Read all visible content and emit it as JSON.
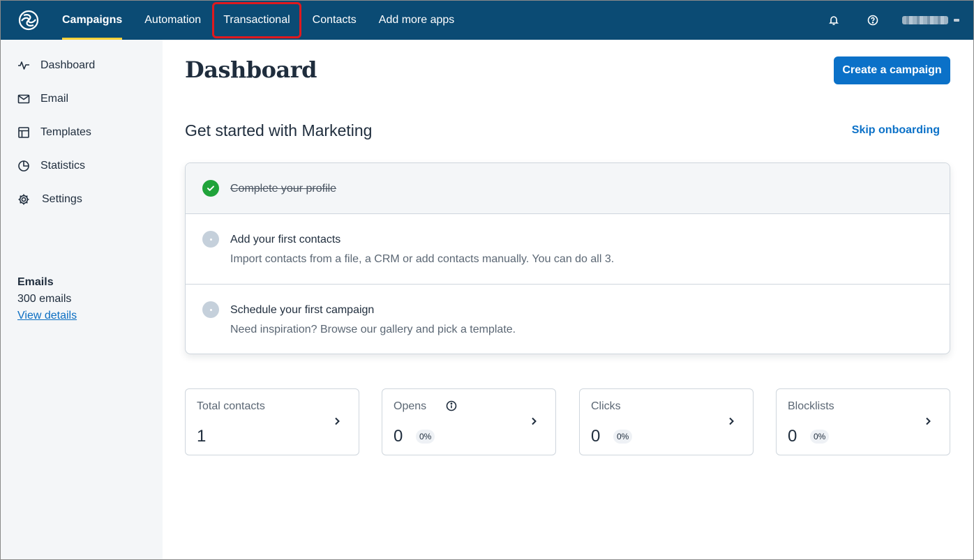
{
  "colors": {
    "nav_bg": "#0b4b74",
    "active_underline": "#f8d13a",
    "highlight_box": "#e0191e",
    "primary": "#0b71c8",
    "done_green": "#20a33a",
    "sidebar_bg": "#f4f6f8"
  },
  "topnav": {
    "logo_icon": "brevo-logo-icon",
    "items": [
      {
        "label": "Campaigns",
        "active": true
      },
      {
        "label": "Automation"
      },
      {
        "label": "Transactional",
        "highlighted": true
      },
      {
        "label": "Contacts"
      },
      {
        "label": "Add more apps"
      }
    ],
    "notifications_icon": "bell-icon",
    "help_icon": "help-circle-icon"
  },
  "sidebar": {
    "items": [
      {
        "label": "Dashboard",
        "icon": "activity-icon",
        "active": true
      },
      {
        "label": "Email",
        "icon": "mail-icon"
      },
      {
        "label": "Templates",
        "icon": "layout-icon"
      },
      {
        "label": "Statistics",
        "icon": "pie-chart-icon"
      },
      {
        "label": "Settings",
        "icon": "gear-icon"
      }
    ],
    "quota": {
      "title": "Emails",
      "value": "300 emails",
      "link": "View details"
    }
  },
  "main": {
    "title": "Dashboard",
    "create_button": "Create a campaign",
    "onboarding": {
      "title": "Get started with Marketing",
      "skip_link": "Skip onboarding",
      "steps": [
        {
          "title": "Complete your profile",
          "done": true
        },
        {
          "title": "Add your first contacts",
          "description": "Import contacts from a file, a CRM or add contacts manually. You can do all 3."
        },
        {
          "title": "Schedule your first campaign",
          "description": "Need inspiration? Browse our gallery and pick a template."
        }
      ]
    },
    "stats": [
      {
        "label": "Total contacts",
        "value": "1"
      },
      {
        "label": "Opens",
        "value": "0",
        "percent": "0%"
      },
      {
        "label": "Clicks",
        "value": "0",
        "percent": "0%"
      },
      {
        "label": "Blocklists",
        "value": "0",
        "percent": "0%"
      }
    ]
  }
}
